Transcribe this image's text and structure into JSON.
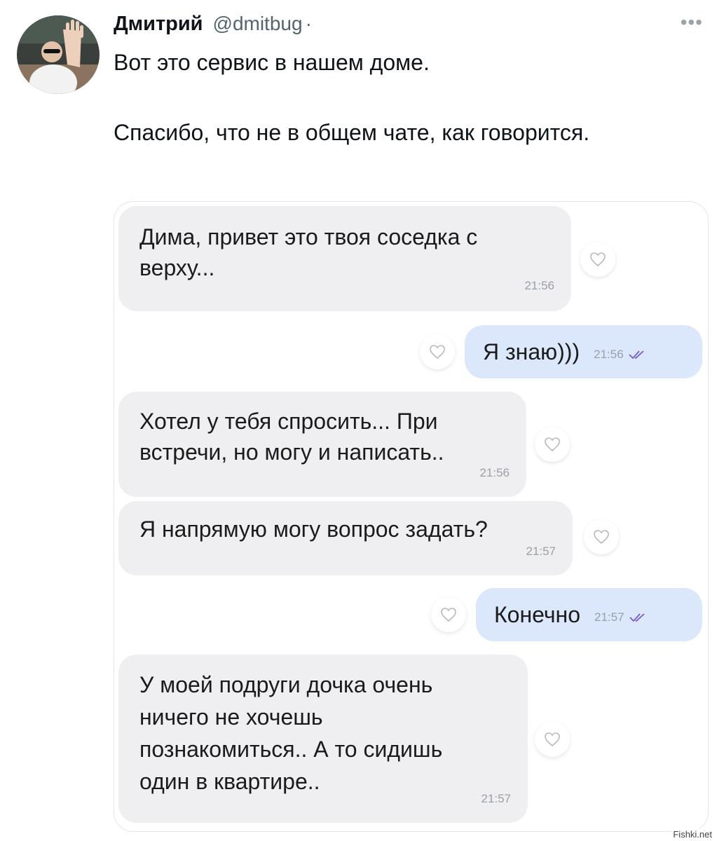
{
  "tweet": {
    "author_name": "Дмитрий",
    "handle": "@dmitbug",
    "separator": "·",
    "more_icon": "more-icon",
    "text_line1": "Вот это сервис в нашем доме.",
    "text_line2": "Спасибо, что не в общем чате, как говорится."
  },
  "chat": {
    "messages": [
      {
        "direction": "in",
        "text": "Дима, привет это твоя соседка с\nверху...",
        "time": "21:56"
      },
      {
        "direction": "out",
        "text": "Я знаю)))",
        "time": "21:56"
      },
      {
        "direction": "in",
        "text": "Хотел у тебя спросить... При\nвстречи, но могу и написать..",
        "time": "21:56"
      },
      {
        "direction": "in",
        "text": "Я напрямую могу вопрос задать?",
        "time": "21:57"
      },
      {
        "direction": "out",
        "text": "Конечно",
        "time": "21:57"
      },
      {
        "direction": "in",
        "text": "У моей подруги дочка очень\nничего не хочешь\nпознакомиться.. А то сидишь\nодин в квартире..",
        "time": "21:57"
      }
    ]
  },
  "watermark": "Fishki.net",
  "colors": {
    "incoming_bubble": "#efeff2",
    "outgoing_bubble": "#dbe8fb",
    "read_ticks": "#7a5cc7"
  }
}
